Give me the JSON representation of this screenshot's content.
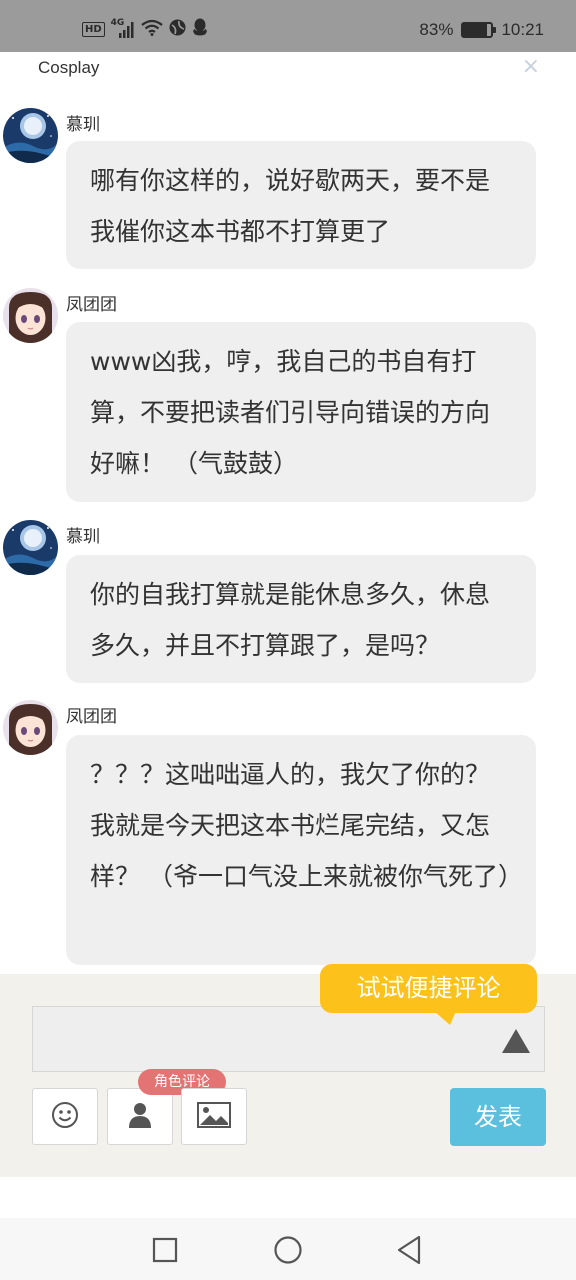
{
  "status_bar": {
    "hd": "HD",
    "net": "4G",
    "battery": "83%",
    "battery_level": 0.83,
    "time": "10:21"
  },
  "header": {
    "title": "Cosplay",
    "close": "×"
  },
  "messages": [
    {
      "user": "慕玔",
      "text": "哪有你这样的，说好歇两天，要不是我催你这本书都不打算更了",
      "avatar": "night-sky-avatar"
    },
    {
      "user": "凤团团",
      "text": "www凶我，哼，我自己的书自有打算，不要把读者们引导向错误的方向好嘛！ （气鼓鼓）",
      "avatar": "anime-girl-avatar"
    },
    {
      "user": "慕玔",
      "text": "你的自我打算就是能休息多久，休息多久，并且不打算跟了，是吗？",
      "avatar": "night-sky-avatar"
    },
    {
      "user": "凤团团",
      "text": "？？？这咄咄逼人的，我欠了你的？ 我就是今天把这本书烂尾完结，又怎样？ （爷一口气没上来就被你气死了）",
      "avatar": "anime-girl-avatar"
    }
  ],
  "comment": {
    "tooltip": "试试便捷评论",
    "input_value": "",
    "role_badge": "角色评论",
    "send": "发表"
  },
  "icons": [
    "wifi-icon",
    "signal-icon",
    "qq-icon",
    "battery-icon",
    "close-icon",
    "expand-up-icon",
    "emoji-icon",
    "person-icon",
    "image-icon",
    "nav-recent-icon",
    "nav-home-icon",
    "nav-back-icon"
  ],
  "colors": {
    "status_bar": "#9b9b9b",
    "bubble": "#efefef",
    "tooltip": "#fcc21b",
    "badge": "#e47474",
    "send": "#5bc0de",
    "comment_bg": "#f2f1ec"
  }
}
